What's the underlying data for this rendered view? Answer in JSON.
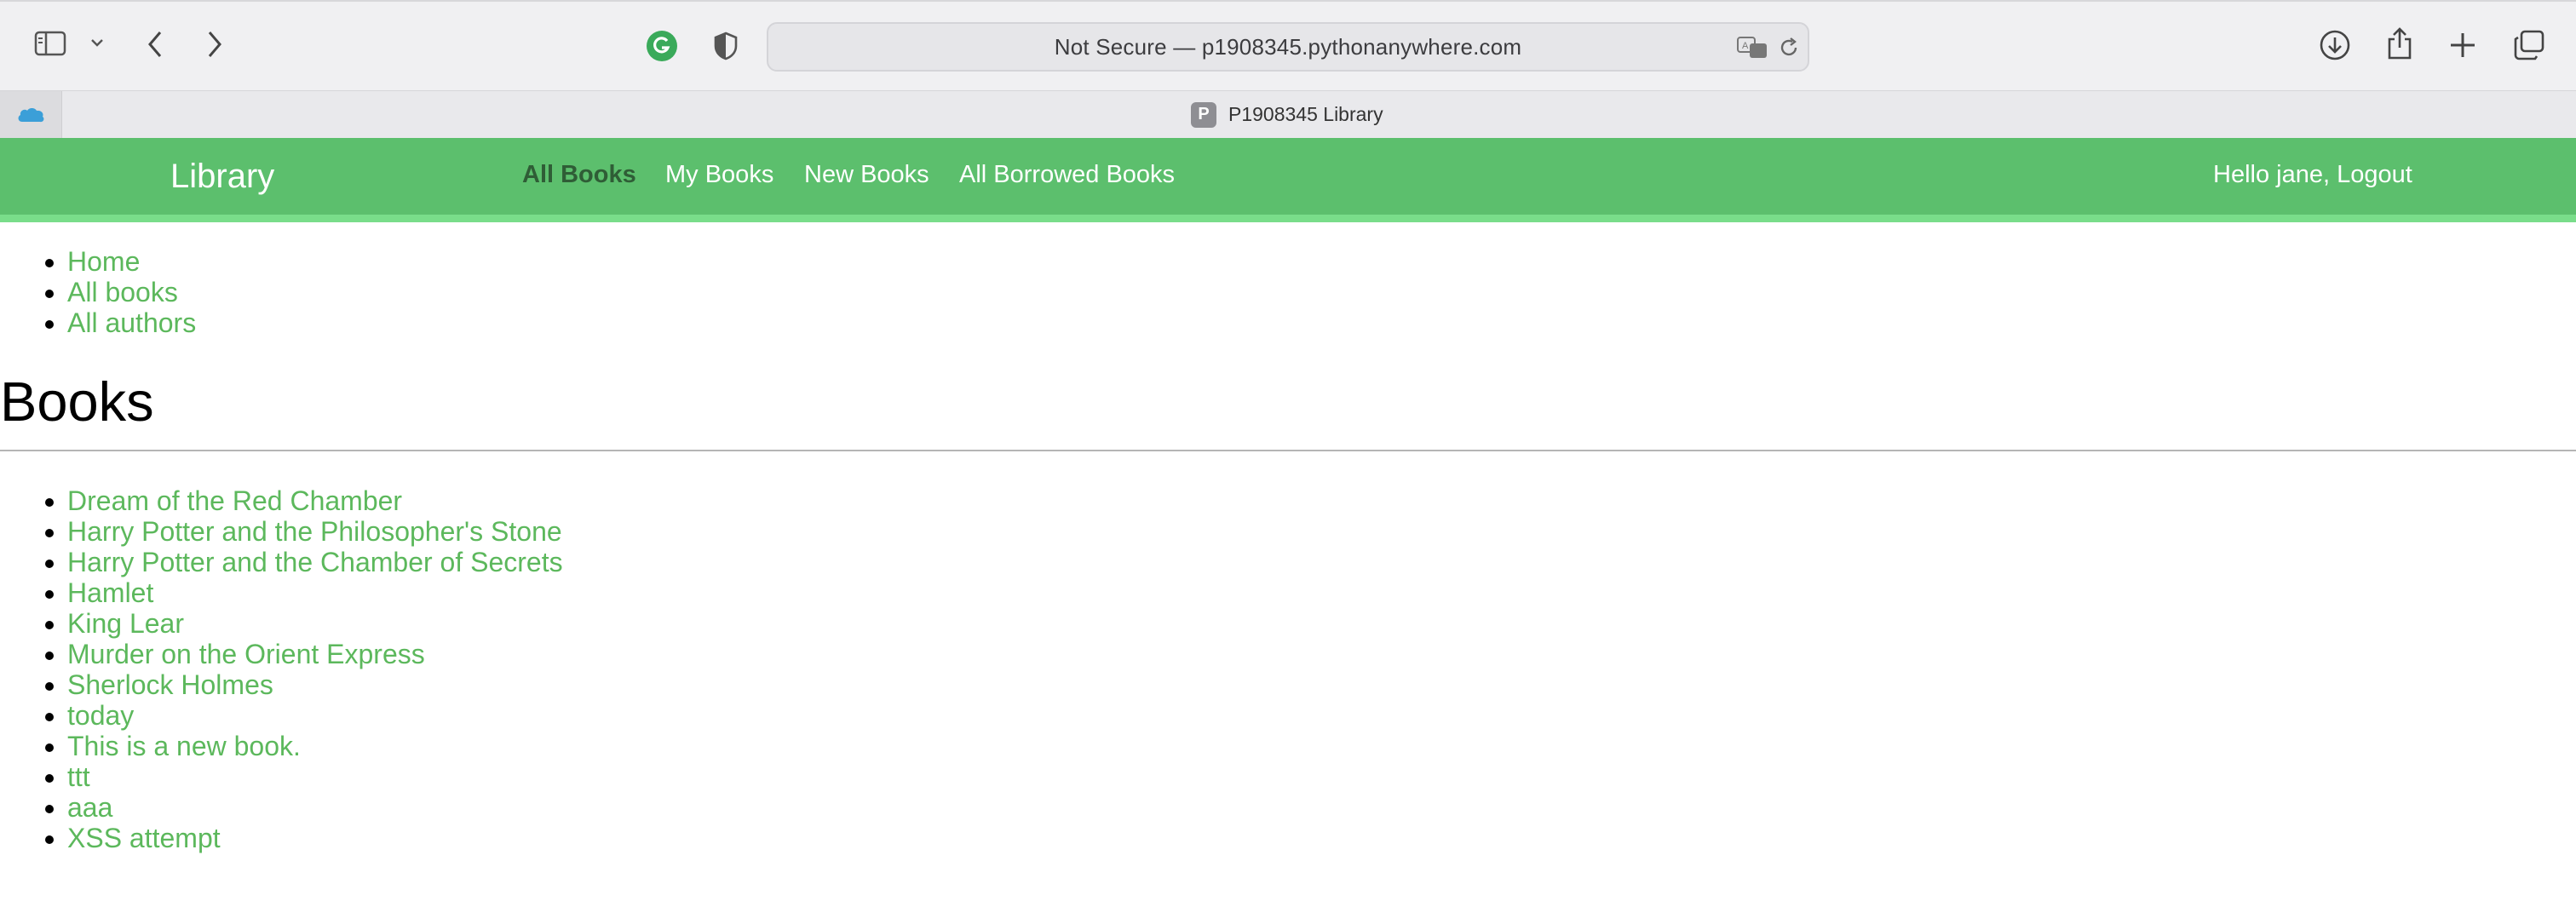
{
  "browser": {
    "url_text": "Not Secure — p1908345.pythonanywhere.com",
    "tab_title": "P1908345 Library",
    "favicon_letter": "P"
  },
  "navbar": {
    "brand": "Library",
    "links": [
      {
        "label": "All Books",
        "active": true
      },
      {
        "label": "My Books",
        "active": false
      },
      {
        "label": "New Books",
        "active": false
      },
      {
        "label": "All Borrowed Books",
        "active": false
      }
    ],
    "user": "Hello jane, Logout"
  },
  "sidebar": {
    "items": [
      {
        "label": "Home"
      },
      {
        "label": "All books"
      },
      {
        "label": "All authors"
      }
    ]
  },
  "main": {
    "title": "Books",
    "books": [
      "Dream of the Red Chamber",
      "Harry Potter and the Philosopher's Stone",
      "Harry Potter and the Chamber of Secrets",
      "Hamlet",
      "King Lear",
      "Murder on the Orient Express",
      "Sherlock Holmes",
      "today",
      "This is a new book.",
      "ttt",
      "aaa",
      "XSS attempt"
    ]
  },
  "colors": {
    "navbar_bg": "#5cbf6d",
    "navbar_border": "#79dd8a",
    "link": "#5cb85c",
    "active_nav": "#2f5d36"
  }
}
